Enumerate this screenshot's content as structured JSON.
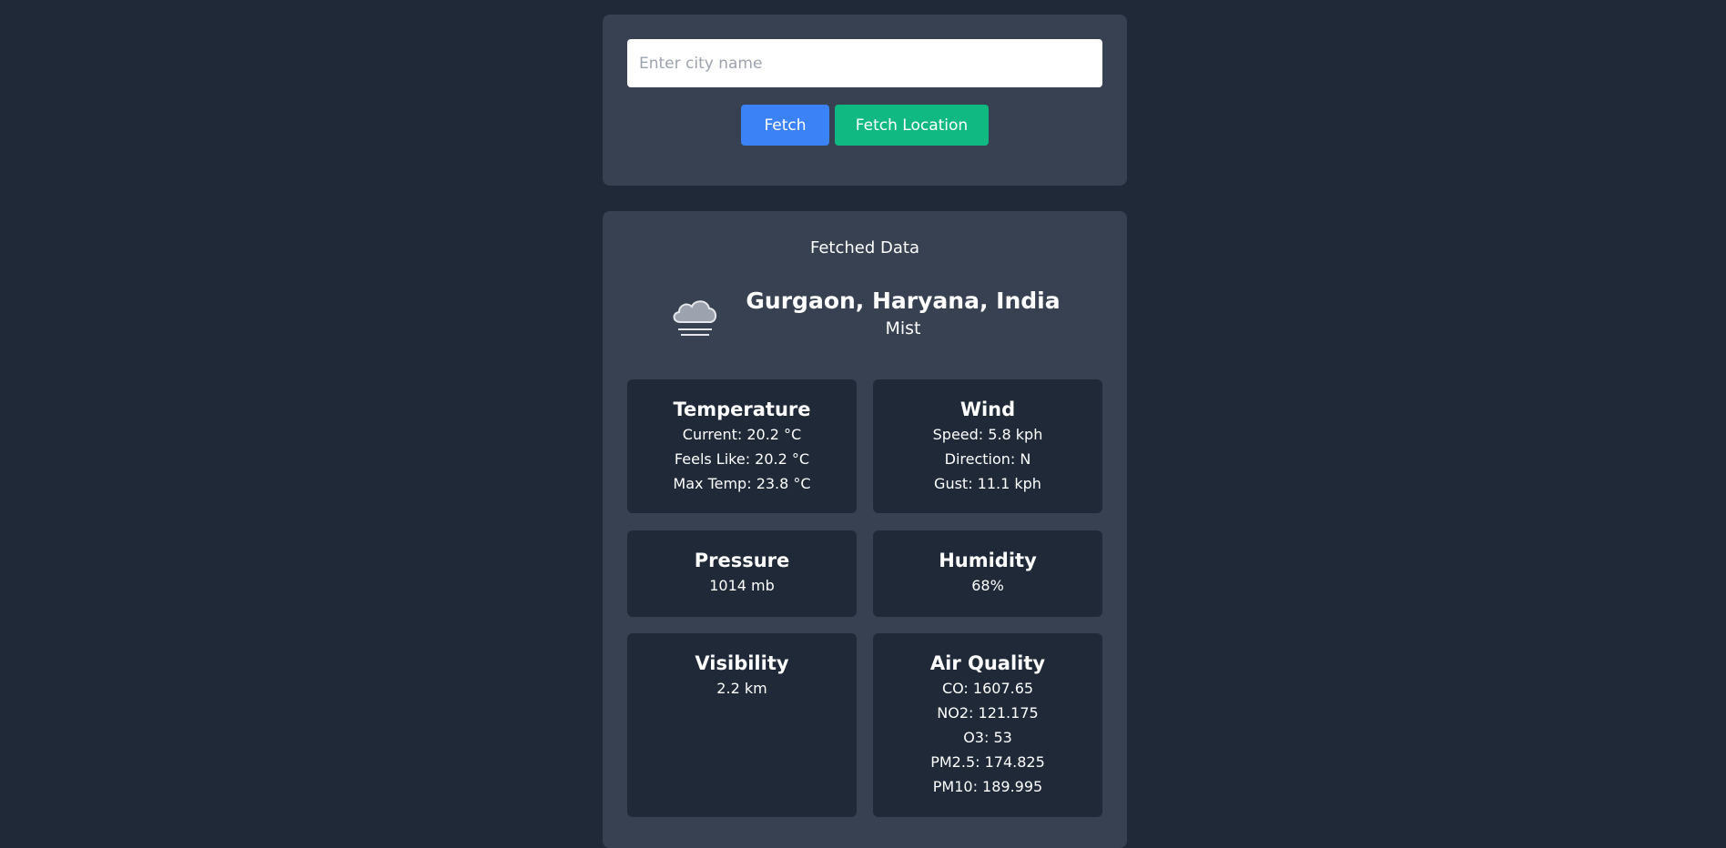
{
  "search": {
    "placeholder": "Enter city name",
    "value": "",
    "fetch_label": "Fetch",
    "fetch_location_label": "Fetch Location"
  },
  "colors": {
    "background": "#1f2937",
    "card": "#374151",
    "fetch_button": "#3b82f6",
    "fetch_location_button": "#10b981"
  },
  "result": {
    "title": "Fetched Data",
    "icon": "mist-cloud-icon",
    "location": "Gurgaon, Haryana, India",
    "condition": "Mist",
    "temperature": {
      "heading": "Temperature",
      "current": "Current: 20.2 °C",
      "feels_like": "Feels Like: 20.2 °C",
      "max_temp": "Max Temp: 23.8 °C"
    },
    "wind": {
      "heading": "Wind",
      "speed": "Speed: 5.8 kph",
      "direction": "Direction: N",
      "gust": "Gust: 11.1 kph"
    },
    "pressure": {
      "heading": "Pressure",
      "value": "1014 mb"
    },
    "humidity": {
      "heading": "Humidity",
      "value": "68%"
    },
    "visibility": {
      "heading": "Visibility",
      "value": "2.2 km"
    },
    "air_quality": {
      "heading": "Air Quality",
      "co": "CO: 1607.65",
      "no2": "NO2: 121.175",
      "o3": "O3: 53",
      "pm25": "PM2.5: 174.825",
      "pm10": "PM10: 189.995"
    }
  }
}
